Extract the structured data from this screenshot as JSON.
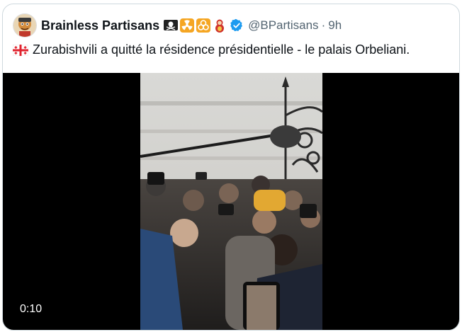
{
  "tweet": {
    "author_name": "Brainless Partisans",
    "handle": "@BPartisans",
    "separator": "·",
    "time": "9h",
    "header_emojis": [
      "skull-crossbones-flag-icon",
      "radioactive-icon",
      "biohazard-icon",
      "matryoshka-doll-icon"
    ],
    "verified_icon": "verified-badge-icon",
    "flag_icon": "georgia-flag-icon",
    "text": "Zurabishvili a quitté la résidence présidentielle - le palais Orbeliani."
  },
  "video": {
    "duration": "0:10"
  },
  "colors": {
    "text_primary": "#0f1419",
    "text_secondary": "#536471",
    "verified_blue": "#1d9bf0",
    "border": "#cfd9de"
  }
}
